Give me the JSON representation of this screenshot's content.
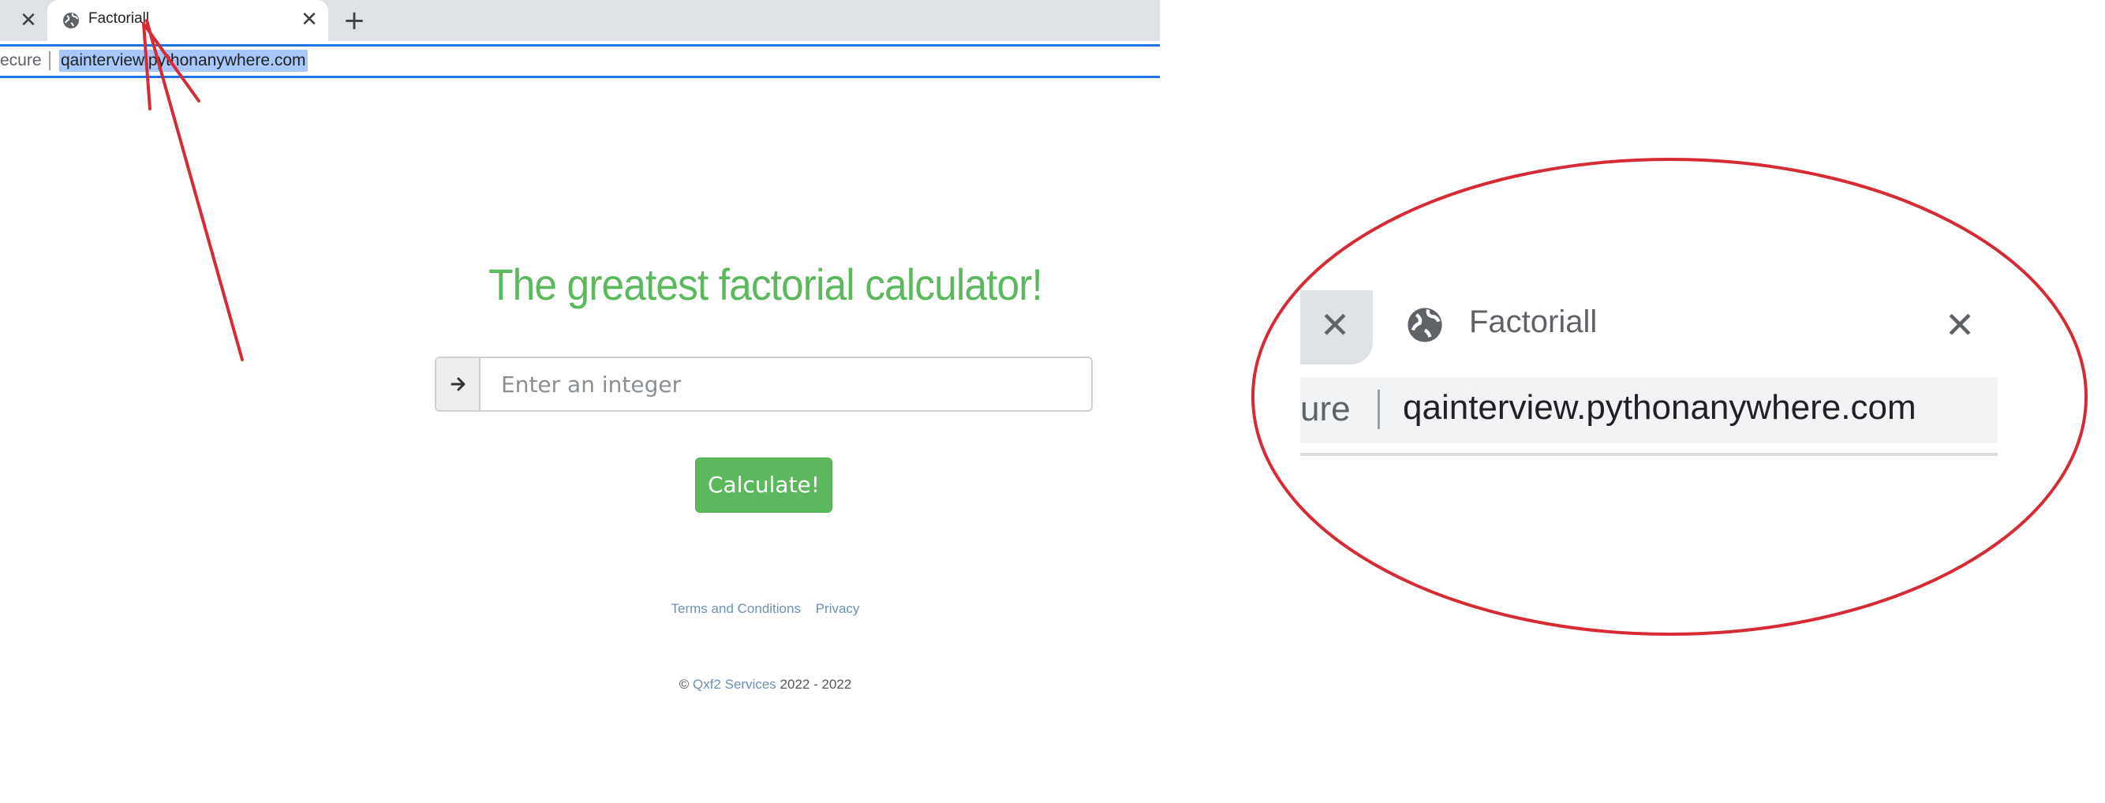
{
  "browser": {
    "prev_tab_close_glyph": "✕",
    "tab": {
      "title": "Factoriall",
      "icon": "globe-icon",
      "close_glyph": "✕"
    },
    "new_tab_glyph": "+",
    "omnibox": {
      "security_text": "ecure",
      "url": "qainterview.pythonanywhere.com"
    }
  },
  "page": {
    "headline": "The greatest factorial calculator!",
    "input": {
      "placeholder": "Enter an integer",
      "value": "",
      "addon_icon": "arrow-right-icon"
    },
    "calculate_label": "Calculate!",
    "footer": {
      "terms": "Terms and Conditions",
      "privacy": "Privacy"
    },
    "copyright": {
      "symbol": "©",
      "company": "Qxf2 Services",
      "years": "2022 - 2022"
    }
  },
  "zoom_inset": {
    "prev_tab_close_glyph": "✕",
    "tab_title": "Factoriall",
    "tab_close_glyph": "✕",
    "security_text": "ure",
    "url": "qainterview.pythonanywhere.com"
  },
  "colors": {
    "accent_green": "#5cb85c",
    "annotation_red": "#d62b35",
    "omnibox_blue": "#1a73e8",
    "link_blue": "#6f8fb3"
  }
}
